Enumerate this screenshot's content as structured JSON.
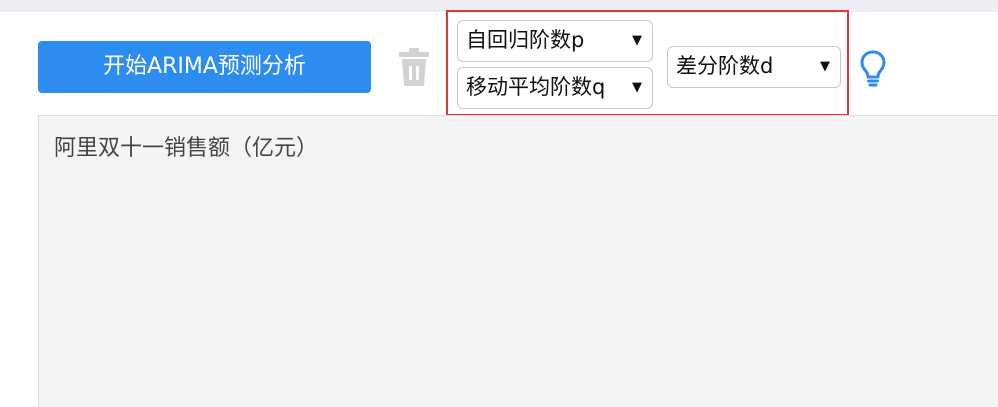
{
  "toolbar": {
    "run_label": "开始ARIMA预测分析",
    "delete_icon": "trash-icon",
    "help_icon": "lightbulb-icon"
  },
  "params": {
    "p_selected": "自回归阶数p",
    "q_selected": "移动平均阶数q",
    "d_selected": "差分阶数d",
    "dropdown_indicator": "▼"
  },
  "data_area": {
    "header_text": "阿里双十一销售额（亿元）"
  },
  "colors": {
    "accent": "#2d8cf0",
    "highlight_border": "#e5333b",
    "editor_bg": "#f4f4f4"
  }
}
